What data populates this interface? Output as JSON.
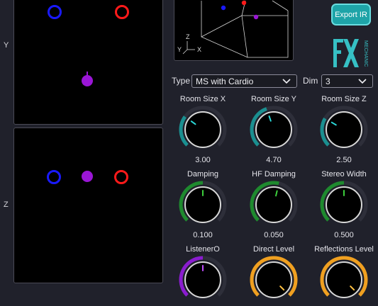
{
  "axes": {
    "y_label": "Y",
    "z_label": "Z",
    "view_axes": {
      "z": "Z",
      "y": "Y",
      "x": "X"
    }
  },
  "colors": {
    "source_left": "#1a1aff",
    "source_right": "#ff1a1a",
    "listener": "#9a16d6",
    "accent": "#1ea4a8",
    "knob_teal": "#1a8f90",
    "knob_green": "#1e8a2e",
    "knob_purple": "#8a1ccf",
    "knob_orange": "#f0a020"
  },
  "toolbar": {
    "export_label": "Export IR"
  },
  "logo": {
    "letters": "FX",
    "side_text": "MECHANIC"
  },
  "config": {
    "type_label": "Type",
    "type_value": "MS with Cardio",
    "dim_label": "Dim",
    "dim_value": "3"
  },
  "knobs": [
    {
      "title": "Room Size X",
      "value": "3.00",
      "level": 0.3,
      "color": "#1a8f90",
      "marker": "#2ad8d8"
    },
    {
      "title": "Room Size Y",
      "value": "4.70",
      "level": 0.43,
      "color": "#1a8f90",
      "marker": "#2ad8d8"
    },
    {
      "title": "Room Size Z",
      "value": "2.50",
      "level": 0.28,
      "color": "#1a8f90",
      "marker": "#2ad8d8"
    },
    {
      "title": "Damping",
      "value": "0.100",
      "level": 0.5,
      "color": "#1e8a2e",
      "marker": "#3ccf3c"
    },
    {
      "title": "HF Damping",
      "value": "0.050",
      "level": 0.55,
      "color": "#1e8a2e",
      "marker": "#3ccf3c"
    },
    {
      "title": "Stereo Width",
      "value": "0.500",
      "level": 0.5,
      "color": "#1e8a2e",
      "marker": "#3ccf3c"
    },
    {
      "title": "ListenerO",
      "value": "",
      "level": 0.5,
      "color": "#8a1ccf",
      "marker": "#c04cff"
    },
    {
      "title": "Direct Level",
      "value": "",
      "level": 1.0,
      "color": "#f0a020",
      "marker": "#ffc040"
    },
    {
      "title": "Reflections Level",
      "value": "",
      "level": 1.0,
      "color": "#f0a020",
      "marker": "#ffc040"
    }
  ]
}
